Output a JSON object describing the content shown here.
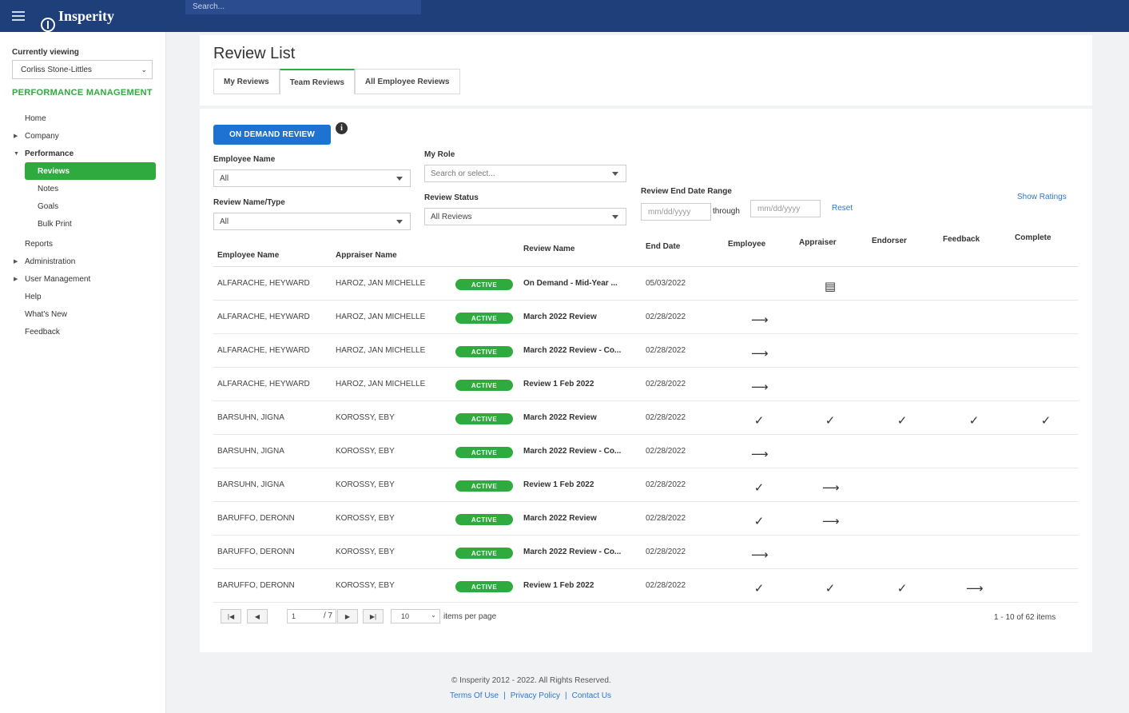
{
  "topbar": {
    "logo_text": "Insperity",
    "search_placeholder": "Search..."
  },
  "sidebar": {
    "currently_viewing_label": "Currently viewing",
    "currently_viewing_value": "Corliss Stone-Littles",
    "section_title": "PERFORMANCE MANAGEMENT",
    "items": [
      {
        "label": "Home"
      },
      {
        "label": "Company"
      },
      {
        "label": "Performance"
      },
      {
        "label": "Reviews"
      },
      {
        "label": "Notes"
      },
      {
        "label": "Goals"
      },
      {
        "label": "Bulk Print"
      },
      {
        "label": "Reports"
      },
      {
        "label": "Administration"
      },
      {
        "label": "User Management"
      },
      {
        "label": "Help"
      },
      {
        "label": "What's New"
      },
      {
        "label": "Feedback"
      }
    ]
  },
  "page": {
    "title": "Review List",
    "tabs": [
      {
        "label": "My Reviews"
      },
      {
        "label": "Team Reviews"
      },
      {
        "label": "All Employee Reviews"
      }
    ],
    "on_demand_button": "ON DEMAND REVIEW",
    "info_icon": "i"
  },
  "filters": {
    "employee_name_label": "Employee Name",
    "employee_name_value": "All",
    "review_name_label": "Review Name/Type",
    "review_name_value": "All",
    "my_role_label": "My Role",
    "my_role_placeholder": "Search or select...",
    "review_status_label": "Review Status",
    "review_status_value": "All Reviews",
    "date_range_label": "Review End Date Range",
    "date_from_placeholder": "mm/dd/yyyy",
    "through_label": "through",
    "date_to_placeholder": "mm/dd/yyyy",
    "reset_label": "Reset",
    "show_ratings_label": "Show Ratings"
  },
  "table": {
    "columns": [
      "Employee Name",
      "Appraiser Name",
      "Review Name",
      "End Date",
      "Employee",
      "Appraiser",
      "Endorser",
      "Feedback",
      "Complete"
    ],
    "rows": [
      {
        "employee": "ALFARACHE, HEYWARD",
        "appraiser": "HAROZ, JAN MICHELLE",
        "status": "ACTIVE",
        "review": "On Demand - Mid-Year ...",
        "end": "05/03/2022",
        "marks": [
          "",
          "doc",
          "",
          "",
          ""
        ]
      },
      {
        "employee": "ALFARACHE, HEYWARD",
        "appraiser": "HAROZ, JAN MICHELLE",
        "status": "ACTIVE",
        "review": "March 2022 Review",
        "end": "02/28/2022",
        "marks": [
          "arrow",
          "",
          "",
          "",
          ""
        ]
      },
      {
        "employee": "ALFARACHE, HEYWARD",
        "appraiser": "HAROZ, JAN MICHELLE",
        "status": "ACTIVE",
        "review": "March 2022 Review - Co...",
        "end": "02/28/2022",
        "marks": [
          "arrow",
          "",
          "",
          "",
          ""
        ]
      },
      {
        "employee": "ALFARACHE, HEYWARD",
        "appraiser": "HAROZ, JAN MICHELLE",
        "status": "ACTIVE",
        "review": "Review 1 Feb 2022",
        "end": "02/28/2022",
        "marks": [
          "arrow",
          "",
          "",
          "",
          ""
        ]
      },
      {
        "employee": "BARSUHN, JIGNA",
        "appraiser": "KOROSSY, EBY",
        "status": "ACTIVE",
        "review": "March 2022 Review",
        "end": "02/28/2022",
        "marks": [
          "check",
          "check",
          "check",
          "check",
          "check"
        ]
      },
      {
        "employee": "BARSUHN, JIGNA",
        "appraiser": "KOROSSY, EBY",
        "status": "ACTIVE",
        "review": "March 2022 Review - Co...",
        "end": "02/28/2022",
        "marks": [
          "arrow",
          "",
          "",
          "",
          ""
        ]
      },
      {
        "employee": "BARSUHN, JIGNA",
        "appraiser": "KOROSSY, EBY",
        "status": "ACTIVE",
        "review": "Review 1 Feb 2022",
        "end": "02/28/2022",
        "marks": [
          "check",
          "arrow",
          "",
          "",
          ""
        ]
      },
      {
        "employee": "BARUFFO, DERONN",
        "appraiser": "KOROSSY, EBY",
        "status": "ACTIVE",
        "review": "March 2022 Review",
        "end": "02/28/2022",
        "marks": [
          "check",
          "arrow",
          "",
          "",
          ""
        ]
      },
      {
        "employee": "BARUFFO, DERONN",
        "appraiser": "KOROSSY, EBY",
        "status": "ACTIVE",
        "review": "March 2022 Review - Co...",
        "end": "02/28/2022",
        "marks": [
          "arrow",
          "",
          "",
          "",
          ""
        ]
      },
      {
        "employee": "BARUFFO, DERONN",
        "appraiser": "KOROSSY, EBY",
        "status": "ACTIVE",
        "review": "Review 1 Feb 2022",
        "end": "02/28/2022",
        "marks": [
          "check",
          "check",
          "check",
          "arrow",
          ""
        ]
      }
    ]
  },
  "pager": {
    "page_value": "1",
    "of_pages": "/ 7",
    "per_page_value": "10",
    "per_page_label": "items per page",
    "summary": "1 - 10 of 62 items",
    "buttons": [
      "|◀",
      "◀",
      "▶",
      "▶|"
    ]
  },
  "footer": {
    "copyright": "© Insperity 2012 - 2022. All Rights Reserved.",
    "links": [
      "Terms Of Use",
      "Privacy Policy",
      "Contact Us"
    ],
    "separator": "|"
  },
  "icons": {
    "check": "✓",
    "arrow": "⟶",
    "doc": "▤",
    "chevron": "⌄"
  },
  "colors": {
    "brand_blue": "#1f3f7a",
    "accent_green": "#2eaa3f",
    "button_blue": "#1e72d1",
    "link_blue": "#2f77c9"
  }
}
